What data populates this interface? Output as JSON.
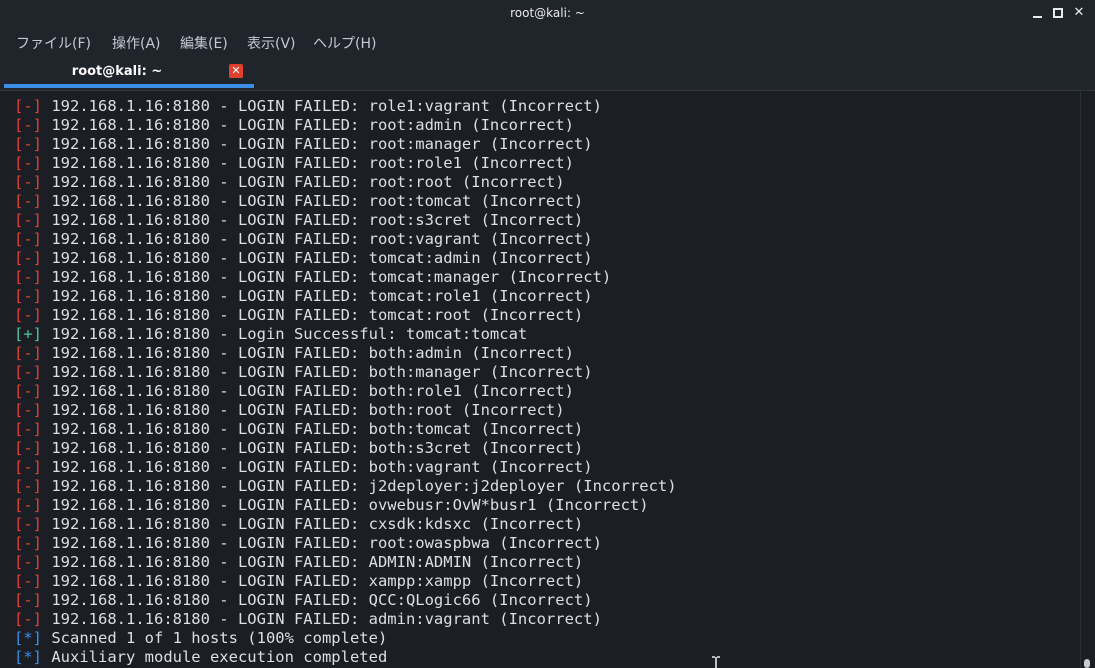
{
  "window": {
    "title": "root@kali: ~",
    "minimize_glyph": "",
    "close_glyph": "✕"
  },
  "menu": {
    "items": [
      "ファイル(F)",
      "操作(A)",
      "編集(E)",
      "表示(V)",
      "ヘルプ(H)"
    ]
  },
  "tab": {
    "label": "root@kali: ~",
    "close_glyph": "✕",
    "accent_color": "#3a8ee6"
  },
  "colors": {
    "fail_tag": "#e0412f",
    "success_tag": "#4fc5a3",
    "info_tag": "#3a8ee6"
  },
  "terminal": {
    "lines": [
      {
        "tag": "[-]",
        "kind": "fail",
        "text": " 192.168.1.16:8180 - LOGIN FAILED: role1:vagrant (Incorrect)"
      },
      {
        "tag": "[-]",
        "kind": "fail",
        "text": " 192.168.1.16:8180 - LOGIN FAILED: root:admin (Incorrect)"
      },
      {
        "tag": "[-]",
        "kind": "fail",
        "text": " 192.168.1.16:8180 - LOGIN FAILED: root:manager (Incorrect)"
      },
      {
        "tag": "[-]",
        "kind": "fail",
        "text": " 192.168.1.16:8180 - LOGIN FAILED: root:role1 (Incorrect)"
      },
      {
        "tag": "[-]",
        "kind": "fail",
        "text": " 192.168.1.16:8180 - LOGIN FAILED: root:root (Incorrect)"
      },
      {
        "tag": "[-]",
        "kind": "fail",
        "text": " 192.168.1.16:8180 - LOGIN FAILED: root:tomcat (Incorrect)"
      },
      {
        "tag": "[-]",
        "kind": "fail",
        "text": " 192.168.1.16:8180 - LOGIN FAILED: root:s3cret (Incorrect)"
      },
      {
        "tag": "[-]",
        "kind": "fail",
        "text": " 192.168.1.16:8180 - LOGIN FAILED: root:vagrant (Incorrect)"
      },
      {
        "tag": "[-]",
        "kind": "fail",
        "text": " 192.168.1.16:8180 - LOGIN FAILED: tomcat:admin (Incorrect)"
      },
      {
        "tag": "[-]",
        "kind": "fail",
        "text": " 192.168.1.16:8180 - LOGIN FAILED: tomcat:manager (Incorrect)"
      },
      {
        "tag": "[-]",
        "kind": "fail",
        "text": " 192.168.1.16:8180 - LOGIN FAILED: tomcat:role1 (Incorrect)"
      },
      {
        "tag": "[-]",
        "kind": "fail",
        "text": " 192.168.1.16:8180 - LOGIN FAILED: tomcat:root (Incorrect)"
      },
      {
        "tag": "[+]",
        "kind": "success",
        "text": " 192.168.1.16:8180 - Login Successful: tomcat:tomcat"
      },
      {
        "tag": "[-]",
        "kind": "fail",
        "text": " 192.168.1.16:8180 - LOGIN FAILED: both:admin (Incorrect)"
      },
      {
        "tag": "[-]",
        "kind": "fail",
        "text": " 192.168.1.16:8180 - LOGIN FAILED: both:manager (Incorrect)"
      },
      {
        "tag": "[-]",
        "kind": "fail",
        "text": " 192.168.1.16:8180 - LOGIN FAILED: both:role1 (Incorrect)"
      },
      {
        "tag": "[-]",
        "kind": "fail",
        "text": " 192.168.1.16:8180 - LOGIN FAILED: both:root (Incorrect)"
      },
      {
        "tag": "[-]",
        "kind": "fail",
        "text": " 192.168.1.16:8180 - LOGIN FAILED: both:tomcat (Incorrect)"
      },
      {
        "tag": "[-]",
        "kind": "fail",
        "text": " 192.168.1.16:8180 - LOGIN FAILED: both:s3cret (Incorrect)"
      },
      {
        "tag": "[-]",
        "kind": "fail",
        "text": " 192.168.1.16:8180 - LOGIN FAILED: both:vagrant (Incorrect)"
      },
      {
        "tag": "[-]",
        "kind": "fail",
        "text": " 192.168.1.16:8180 - LOGIN FAILED: j2deployer:j2deployer (Incorrect)"
      },
      {
        "tag": "[-]",
        "kind": "fail",
        "text": " 192.168.1.16:8180 - LOGIN FAILED: ovwebusr:OvW*busr1 (Incorrect)"
      },
      {
        "tag": "[-]",
        "kind": "fail",
        "text": " 192.168.1.16:8180 - LOGIN FAILED: cxsdk:kdsxc (Incorrect)"
      },
      {
        "tag": "[-]",
        "kind": "fail",
        "text": " 192.168.1.16:8180 - LOGIN FAILED: root:owaspbwa (Incorrect)"
      },
      {
        "tag": "[-]",
        "kind": "fail",
        "text": " 192.168.1.16:8180 - LOGIN FAILED: ADMIN:ADMIN (Incorrect)"
      },
      {
        "tag": "[-]",
        "kind": "fail",
        "text": " 192.168.1.16:8180 - LOGIN FAILED: xampp:xampp (Incorrect)"
      },
      {
        "tag": "[-]",
        "kind": "fail",
        "text": " 192.168.1.16:8180 - LOGIN FAILED: QCC:QLogic66 (Incorrect)"
      },
      {
        "tag": "[-]",
        "kind": "fail",
        "text": " 192.168.1.16:8180 - LOGIN FAILED: admin:vagrant (Incorrect)"
      },
      {
        "tag": "[*]",
        "kind": "info",
        "text": " Scanned 1 of 1 hosts (100% complete)"
      },
      {
        "tag": "[*]",
        "kind": "info",
        "text": " Auxiliary module execution completed"
      }
    ]
  }
}
